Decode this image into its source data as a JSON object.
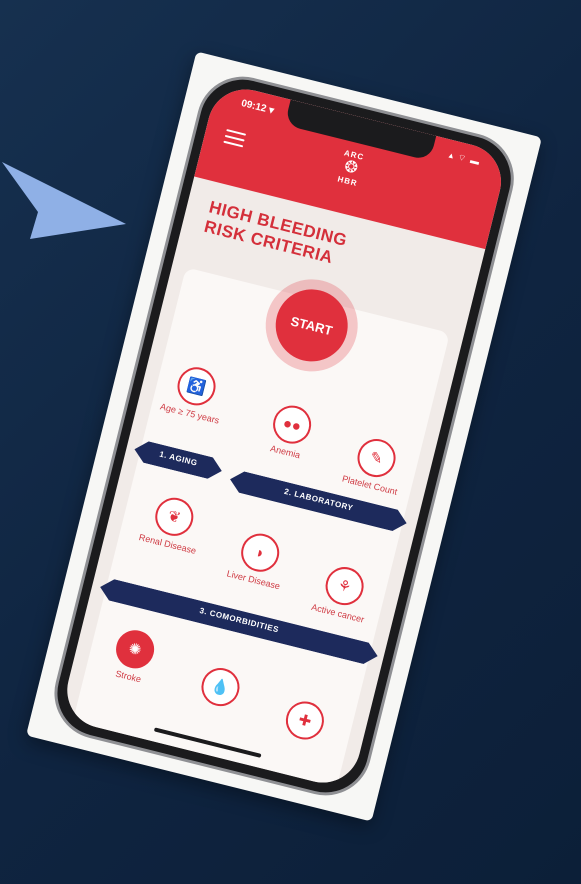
{
  "status": {
    "time": "09:12 ▾",
    "icons": "▴ ⌔ ▬"
  },
  "header": {
    "logo_top": "ARC",
    "logo_bottom": "HBR"
  },
  "title": {
    "line1": "HIGH BLEEDING",
    "line2": "RISK CRITERIA"
  },
  "start_label": "START",
  "criteria": {
    "age": "Age ≥ 75 years",
    "anemia": "Anemia",
    "platelet": "Platelet Count",
    "renal": "Renal Disease",
    "liver": "Liver Disease",
    "cancer": "Active cancer",
    "stroke": "Stroke"
  },
  "banners": {
    "aging": "1. AGING",
    "laboratory": "2. LABORATORY",
    "comorbidities": "3. COMORBIDITIES"
  },
  "icons": {
    "age": "walking-person-icon",
    "anemia": "blood-cells-icon",
    "platelet": "syringe-icon",
    "renal": "kidney-icon",
    "liver": "liver-icon",
    "cancer": "lungs-icon",
    "stroke": "brain-icon",
    "bleed": "blood-drop-icon",
    "meds": "medication-box-icon"
  },
  "colors": {
    "brand_red": "#e0303d",
    "navy": "#1d2a5c",
    "background": "#0f2440"
  }
}
